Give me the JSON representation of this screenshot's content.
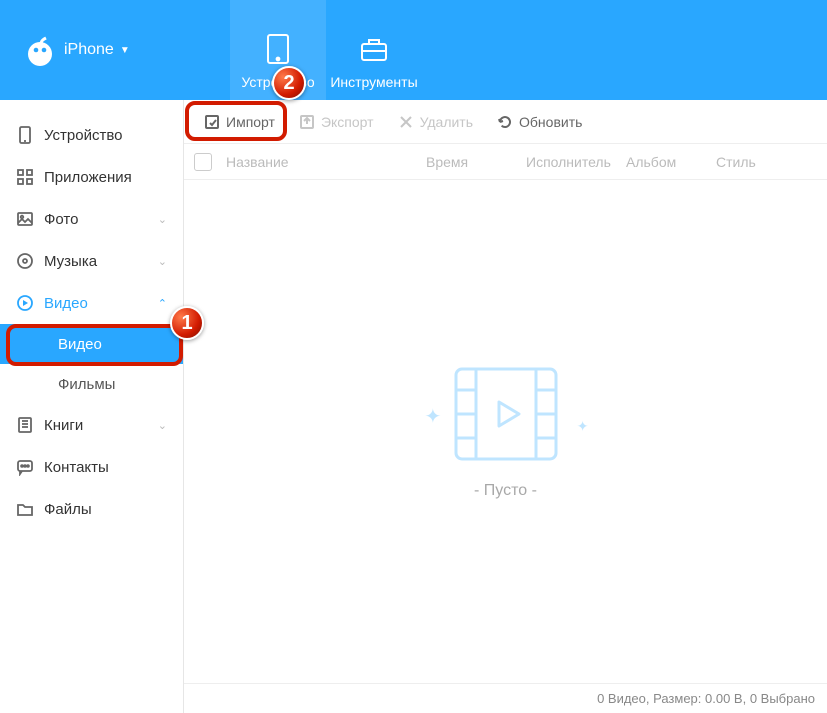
{
  "header": {
    "device_name": "iPhone",
    "tabs": {
      "device": "Устройство",
      "tools": "Инструменты"
    }
  },
  "sidebar": {
    "device": "Устройство",
    "apps": "Приложения",
    "photos": "Фото",
    "music": "Музыка",
    "video": "Видео",
    "video_sub": {
      "video": "Видео",
      "movies": "Фильмы"
    },
    "books": "Книги",
    "contacts": "Контакты",
    "files": "Файлы"
  },
  "toolbar": {
    "import": "Импорт",
    "export": "Экспорт",
    "delete": "Удалить",
    "refresh": "Обновить"
  },
  "columns": {
    "name": "Название",
    "time": "Время",
    "artist": "Исполнитель",
    "album": "Альбом",
    "style": "Стиль"
  },
  "empty_state": "- Пусто -",
  "status_bar": "0 Видео, Размер: 0.00 B, 0 Выбрано",
  "badges": {
    "one": "1",
    "two": "2"
  }
}
